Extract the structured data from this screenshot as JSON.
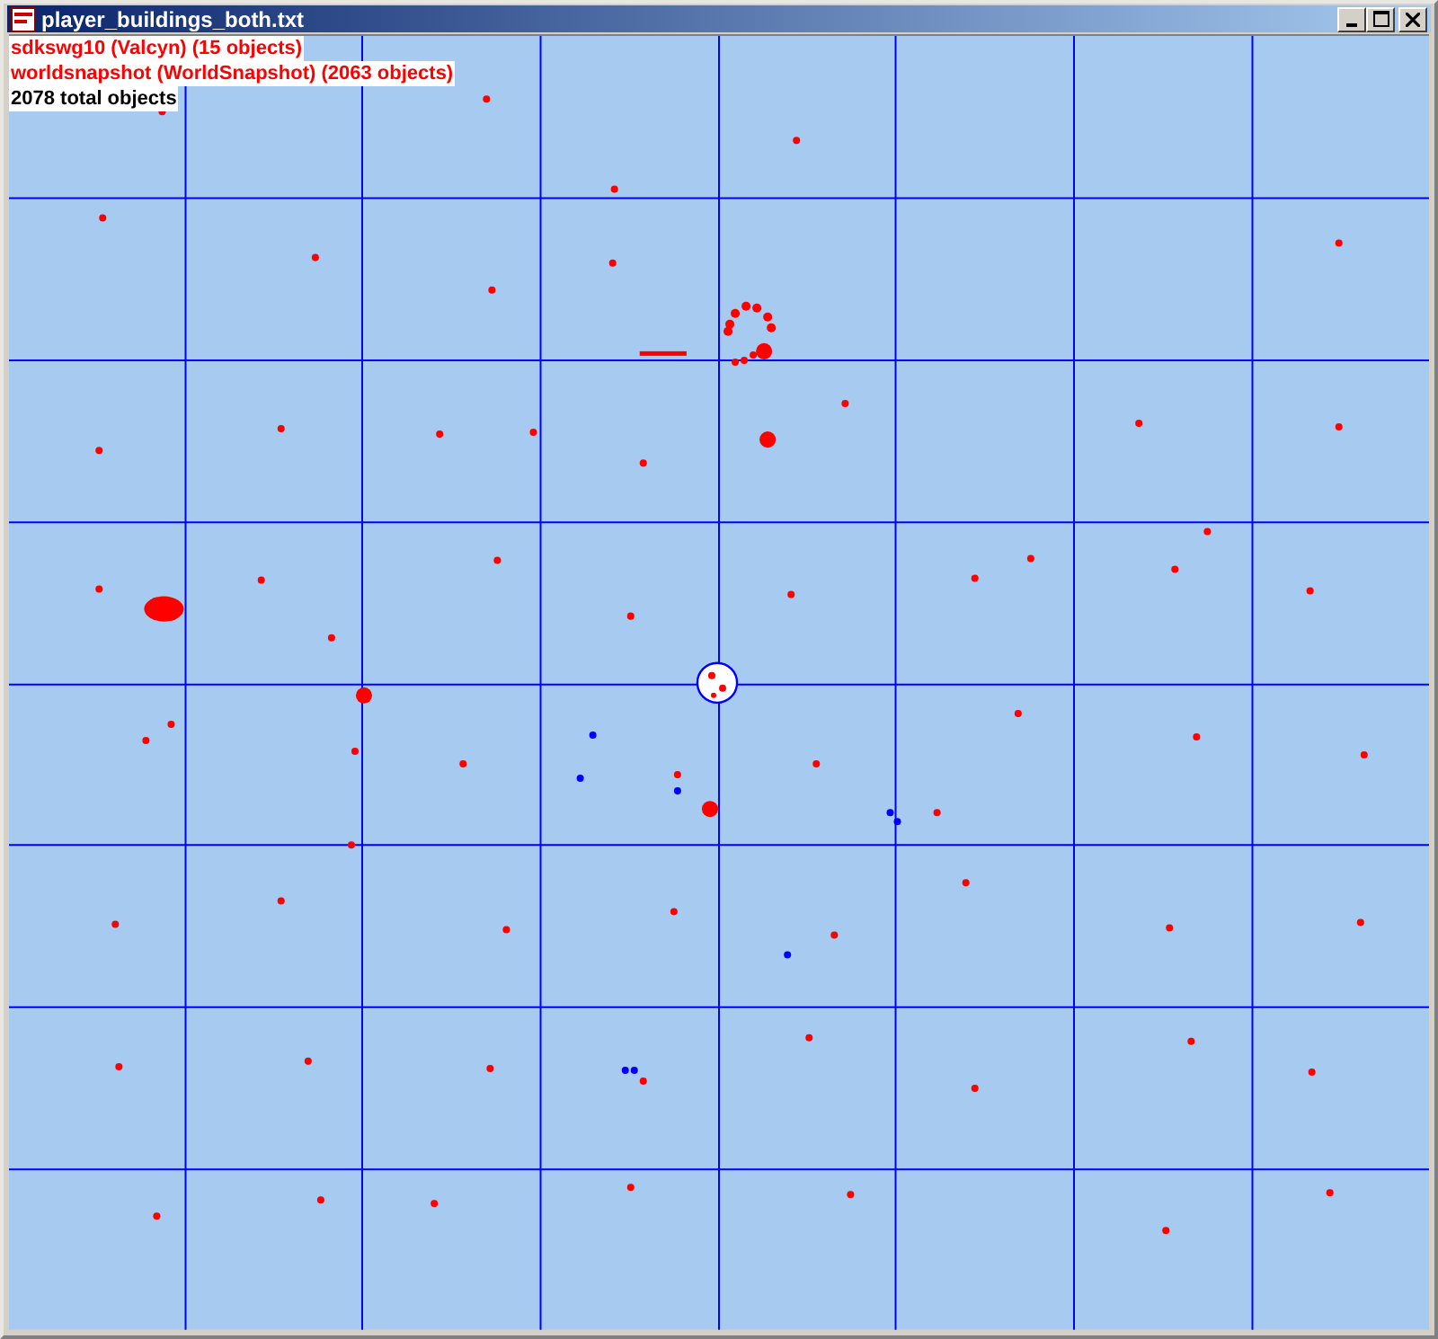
{
  "window": {
    "title": "player_buildings_both.txt"
  },
  "legend": {
    "layers": [
      {
        "label": "sdkswg10 (Valcyn) (15 objects)",
        "color": "#ff0000"
      },
      {
        "label": "worldsnapshot (WorldSnapshot) (2063 objects)",
        "color": "#ff0000"
      }
    ],
    "total": "2078 total objects"
  }
}
